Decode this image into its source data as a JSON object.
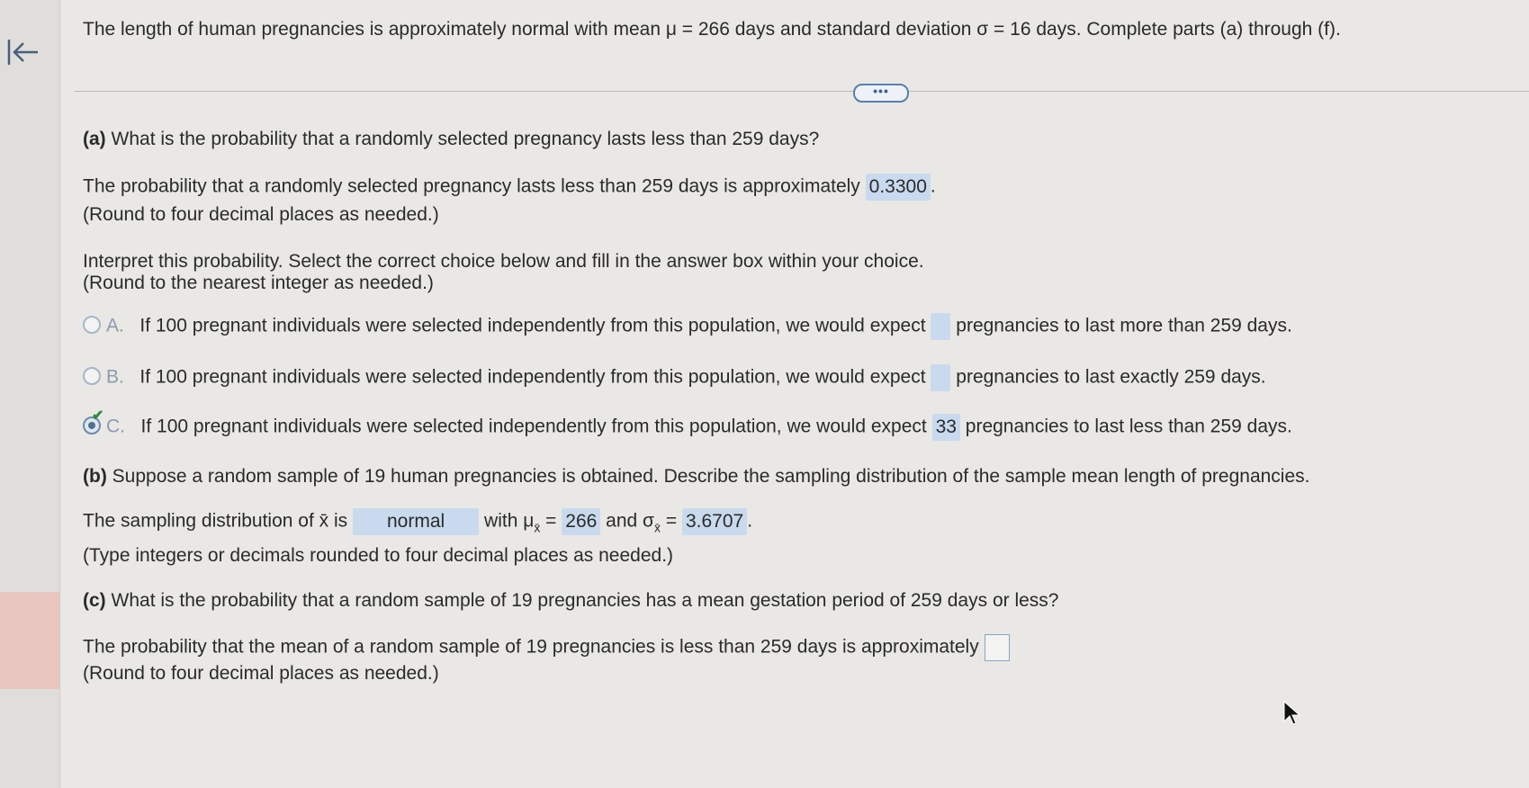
{
  "header": {
    "text": "The length of human pregnancies is approximately normal with mean μ = 266 days and standard deviation σ = 16 days. Complete parts (a) through (f)."
  },
  "more_button": {
    "label": "•••"
  },
  "part_a": {
    "label": "(a)",
    "question": "What is the probability that a randomly selected pregnancy lasts less than 259 days?",
    "answer_prefix": "The probability that a randomly selected pregnancy lasts less than 259 days is approximately",
    "answer_value": "0.3300",
    "answer_suffix": ".",
    "round_note": "(Round to four decimal places as needed.)",
    "interpret_line1": "Interpret this probability. Select the correct choice below and fill in the answer box within your choice.",
    "interpret_line2": "(Round to the nearest integer as needed.)",
    "choices": [
      {
        "letter": "A.",
        "prefix": "If 100 pregnant individuals were selected independently from this population, we would expect",
        "value": "",
        "suffix": "pregnancies to last more than 259 days."
      },
      {
        "letter": "B.",
        "prefix": "If 100 pregnant individuals were selected independently from this population, we would expect",
        "value": "",
        "suffix": "pregnancies to last exactly 259 days."
      },
      {
        "letter": "C.",
        "prefix": "If 100 pregnant individuals were selected independently from this population, we would expect",
        "value": "33",
        "suffix": "pregnancies to last less than 259 days."
      }
    ],
    "selected_choice": "C"
  },
  "part_b": {
    "label": "(b)",
    "question": "Suppose a random sample of 19 human pregnancies is obtained. Describe the sampling distribution of the sample mean length of pregnancies.",
    "sentence_prefix": "The sampling distribution of x̄ is",
    "distribution_value": "normal",
    "with_text": "with μ",
    "sub_x": "x̄",
    "equals": "=",
    "mu_value": "266",
    "and_text": "and σ",
    "sigma_value": "3.6707",
    "end": ".",
    "type_note": "(Type integers or decimals rounded to four decimal places as needed.)"
  },
  "part_c": {
    "label": "(c)",
    "question": "What is the probability that a random sample of 19 pregnancies has a mean gestation period of 259 days or less?",
    "answer_prefix": "The probability that the mean of a random sample of 19 pregnancies is less than 259 days is approximately",
    "answer_value": "",
    "round_note": "(Round to four decimal places as needed.)"
  },
  "colors": {
    "answer_fill": "#c9daee",
    "check_green": "#2f8a3a",
    "link_blue": "#3c5f93"
  }
}
